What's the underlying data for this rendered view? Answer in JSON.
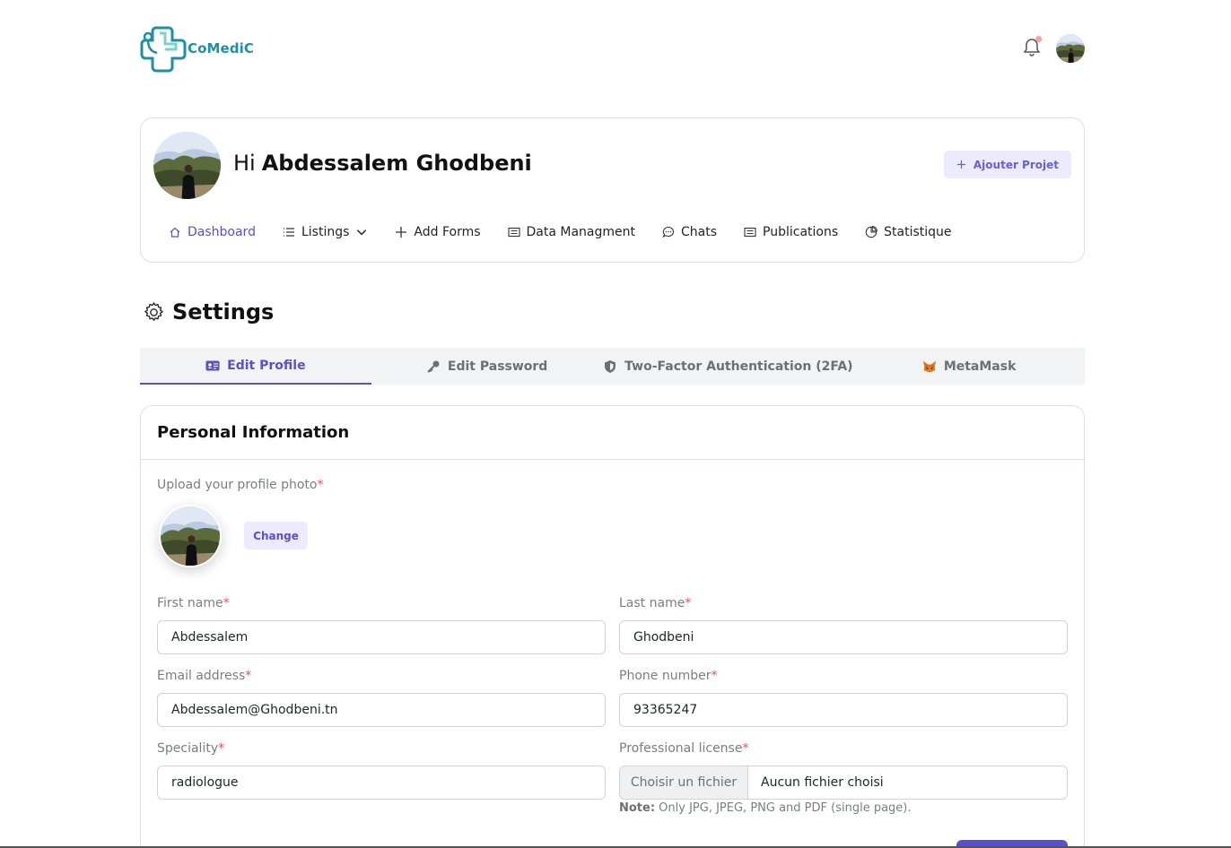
{
  "header": {
    "logo_text": "CoMediC",
    "notification_icon": "bell-icon",
    "avatar": "user-avatar"
  },
  "profile": {
    "greeting": "Hi",
    "name": "Abdessalem Ghodbeni",
    "add_project_label": "Ajouter Projet"
  },
  "nav": {
    "items": [
      {
        "label": "Dashboard",
        "icon": "home-icon",
        "active": true
      },
      {
        "label": "Listings",
        "icon": "list-icon"
      },
      {
        "label": "Add Forms",
        "icon": "plus-icon"
      },
      {
        "label": "Data Managment",
        "icon": "document-icon"
      },
      {
        "label": "Chats",
        "icon": "chat-icon"
      },
      {
        "label": "Publications",
        "icon": "document-icon"
      },
      {
        "label": "Statistique",
        "icon": "pie-chart-icon"
      }
    ]
  },
  "settings": {
    "title": "Settings",
    "tabs": [
      {
        "label": "Edit Profile",
        "icon": "id-card-icon",
        "active": true
      },
      {
        "label": "Edit Password",
        "icon": "key-icon"
      },
      {
        "label": "Two-Factor Authentication (2FA)",
        "icon": "shield-icon"
      },
      {
        "label": "MetaMask",
        "icon": "fox-icon"
      }
    ]
  },
  "form": {
    "section_title": "Personal Information",
    "photo_label": "Upload your profile photo",
    "change_label": "Change",
    "first_name_label": "First name",
    "first_name_value": "Abdessalem",
    "last_name_label": "Last name",
    "last_name_value": "Ghodbeni",
    "email_label": "Email address",
    "email_value": "Abdessalem@Ghodbeni.tn",
    "phone_label": "Phone number",
    "phone_value": "93365247",
    "speciality_label": "Speciality",
    "speciality_value": "radiologue",
    "license_label": "Professional license",
    "file_button": "Choisir un fichier",
    "file_status": "Aucun fichier choisi",
    "note_bold": "Note:",
    "note_text": " Only JPG, JPEG, PNG and PDF (single page).",
    "required_mark": "*"
  },
  "colors": {
    "accent": "#5a4fcf",
    "accent_light": "#eceafe",
    "brand": "#1f8fa3",
    "required": "#e2545f"
  }
}
